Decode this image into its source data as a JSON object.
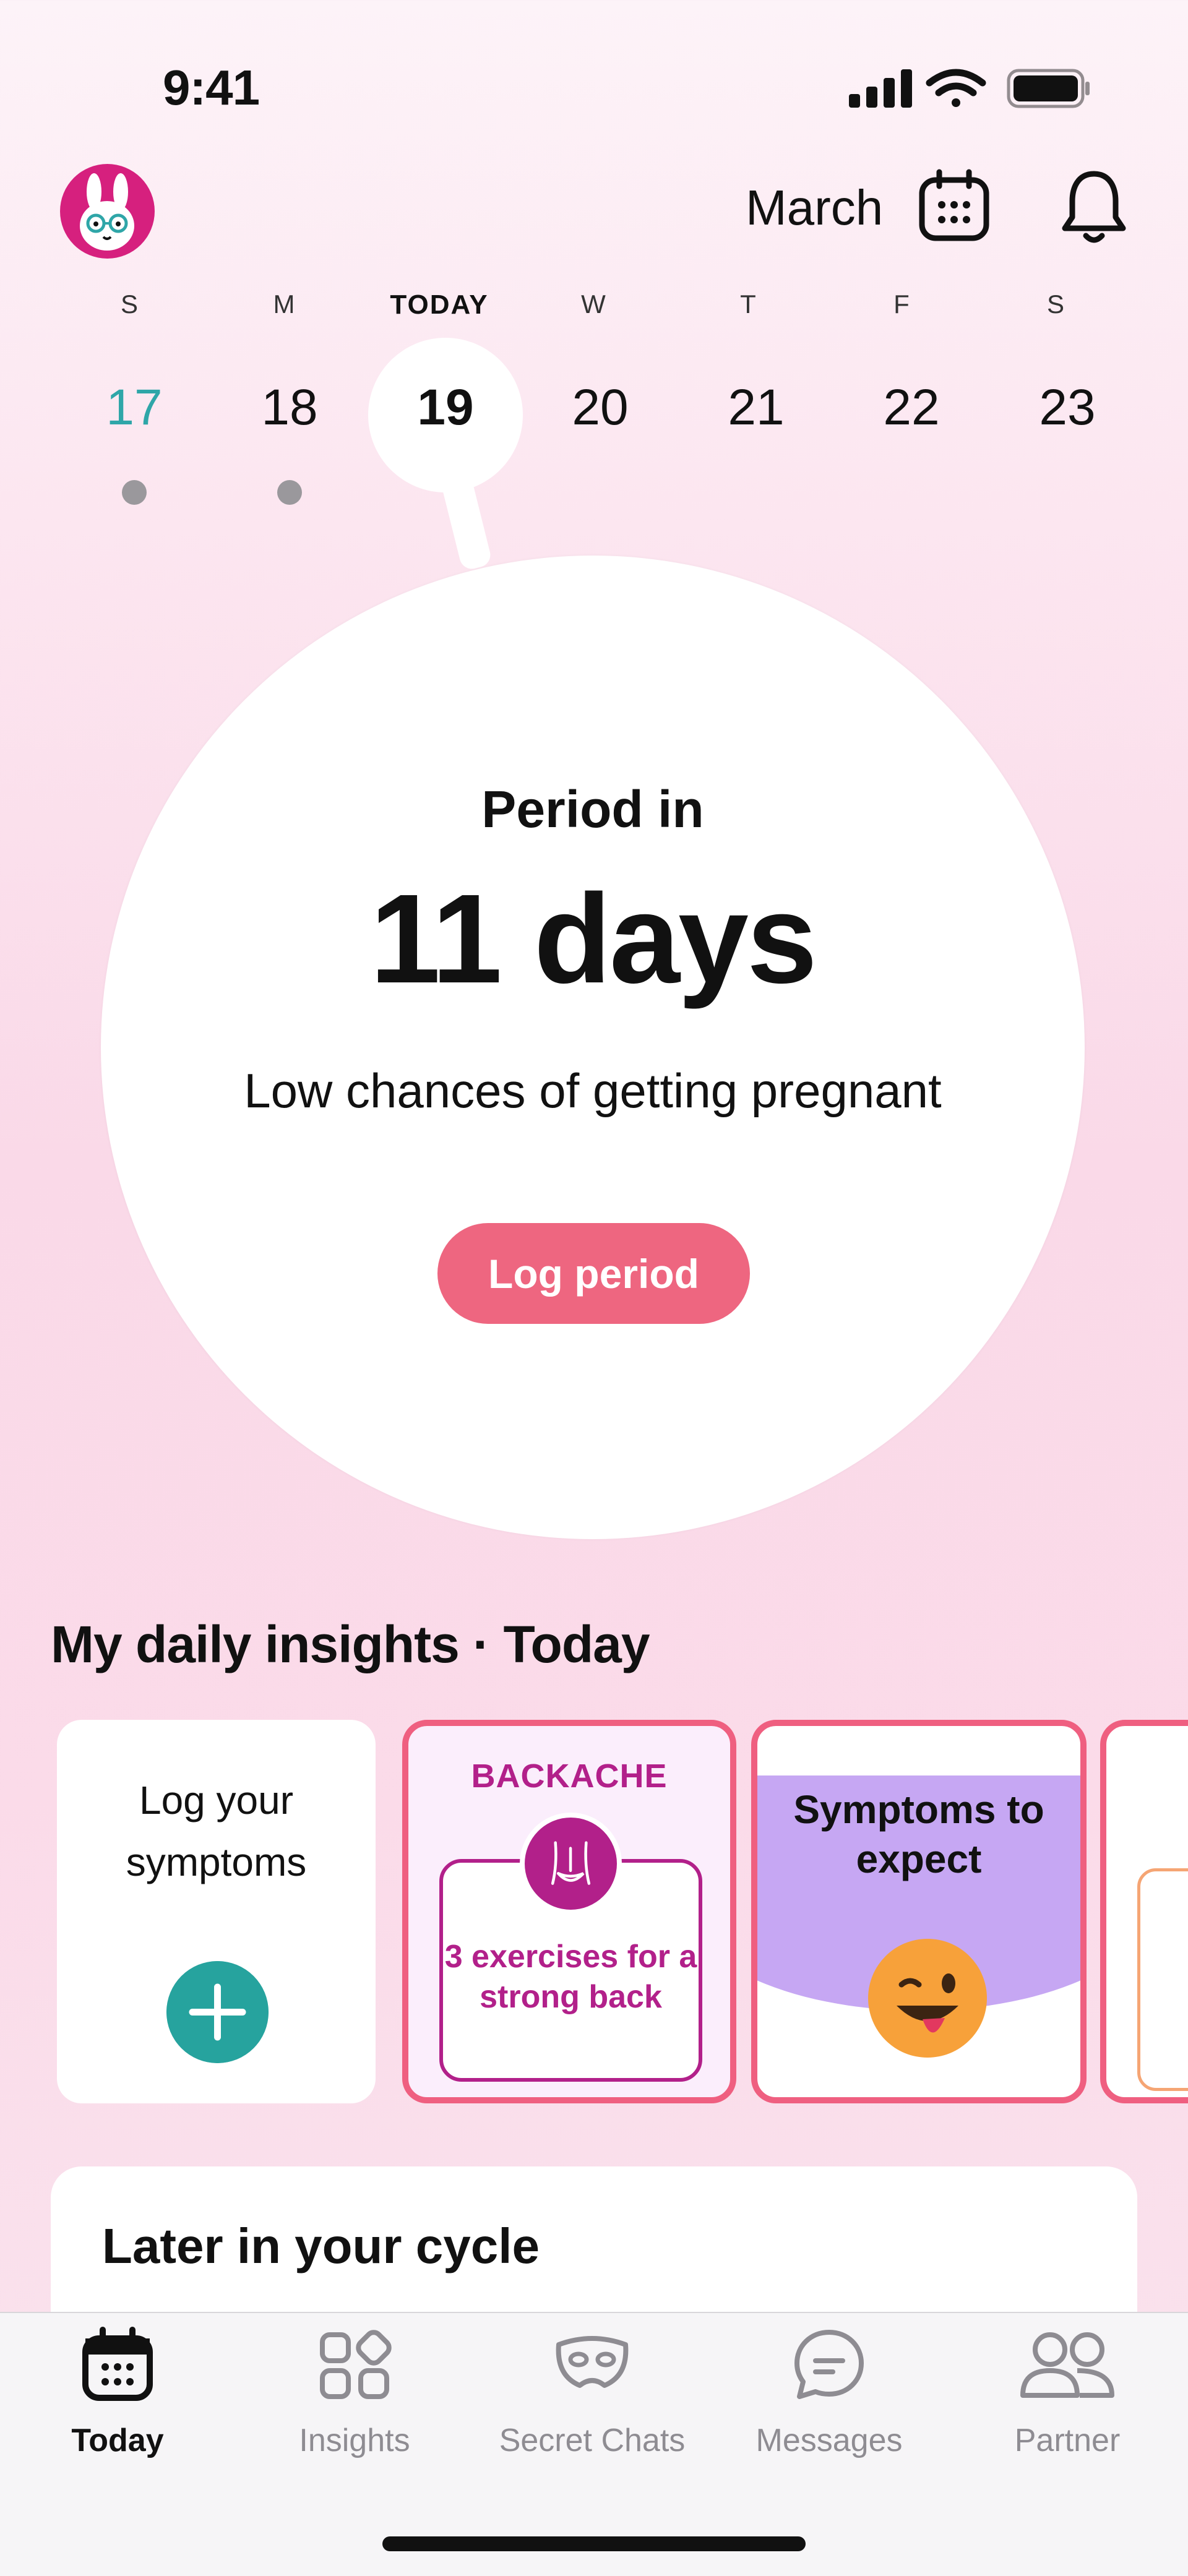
{
  "status_bar": {
    "time": "9:41"
  },
  "header": {
    "month": "March"
  },
  "week": {
    "days": [
      {
        "weekday": "S",
        "date": "17",
        "state": "past",
        "has_dot": true
      },
      {
        "weekday": "M",
        "date": "18",
        "state": "past_plain",
        "has_dot": true
      },
      {
        "weekday": "TODAY",
        "date": "19",
        "state": "today",
        "has_dot": false
      },
      {
        "weekday": "W",
        "date": "20",
        "state": "future",
        "has_dot": false
      },
      {
        "weekday": "T",
        "date": "21",
        "state": "future",
        "has_dot": false
      },
      {
        "weekday": "F",
        "date": "22",
        "state": "future",
        "has_dot": false
      },
      {
        "weekday": "S",
        "date": "23",
        "state": "future",
        "has_dot": false
      }
    ]
  },
  "main": {
    "period_in": "Period in",
    "days": "11 days",
    "chance": "Low chances of getting pregnant",
    "log_button": "Log period"
  },
  "insights": {
    "title": "My daily insights · Today",
    "cards": {
      "log": {
        "title": "Log your symptoms"
      },
      "backache": {
        "tag": "BACKACHE",
        "text": "3 exercises for a strong back"
      },
      "symptoms": {
        "text": "Symptoms to expect"
      }
    }
  },
  "later": {
    "title": "Later in your cycle"
  },
  "tabs": [
    {
      "label": "Today",
      "icon": "calendar-icon",
      "active": true
    },
    {
      "label": "Insights",
      "icon": "grid-icon",
      "active": false
    },
    {
      "label": "Secret Chats",
      "icon": "mask-icon",
      "active": false
    },
    {
      "label": "Messages",
      "icon": "chat-bubble-icon",
      "active": false
    },
    {
      "label": "Partner",
      "icon": "people-icon",
      "active": false
    }
  ],
  "colors": {
    "accent_pink": "#ee6680",
    "teal": "#26a39e",
    "magenta": "#b2208a",
    "lavender": "#c6a7f3"
  }
}
